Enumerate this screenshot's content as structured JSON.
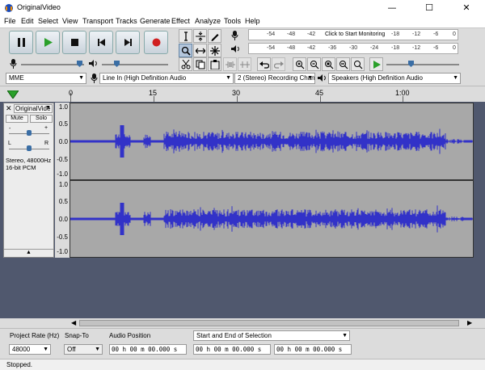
{
  "window": {
    "title": "OriginalVideo",
    "minimize": "—",
    "maximize": "☐",
    "close": "✕"
  },
  "menu": [
    "File",
    "Edit",
    "Select",
    "View",
    "Transport",
    "Tracks",
    "Generate",
    "Effect",
    "Analyze",
    "Tools",
    "Help"
  ],
  "meters": {
    "record_ticks": [
      "-54",
      "-48",
      "-42",
      "-18",
      "-12",
      "-6",
      "0"
    ],
    "record_hint": "Click to Start Monitoring",
    "playback_ticks": [
      "-54",
      "-48",
      "-42",
      "-36",
      "-30",
      "-24",
      "-18",
      "-12",
      "-6",
      "0"
    ]
  },
  "device": {
    "host": "MME",
    "input": "Line In (High Definition Audio",
    "channels": "2 (Stereo) Recording Chan",
    "output": "Speakers (High Definition Audio"
  },
  "ruler": {
    "labels": [
      "0",
      "15",
      "30",
      "45",
      "1:00"
    ]
  },
  "track": {
    "name": "OriginalVide",
    "mute_label": "Mute",
    "solo_label": "Solo",
    "gain_l": "-",
    "gain_r": "+",
    "pan_l": "L",
    "pan_r": "R",
    "info_line1": "Stereo, 48000Hz",
    "info_line2": "16-bit PCM",
    "collapse": "▲",
    "scale": [
      "1.0",
      "0.5",
      "0.0",
      "-0.5",
      "-1.0"
    ]
  },
  "bottom": {
    "project_rate_label": "Project Rate (Hz)",
    "project_rate_value": "48000",
    "snap_label": "Snap-To",
    "snap_value": "Off",
    "position_label": "Audio Position",
    "position_value": "00 h 00 m 00.000 s",
    "selection_label": "Start and End of Selection",
    "selection_start": "00 h 00 m 00.000 s",
    "selection_end": "00 h 00 m 00.000 s"
  },
  "status": {
    "text": "Stopped."
  },
  "colors": {
    "waveform": "#3232c8",
    "wave_bg": "#a8a8a8",
    "track_area": "#50586e",
    "play_green": "#2aa02a",
    "record_red": "#d02020"
  }
}
